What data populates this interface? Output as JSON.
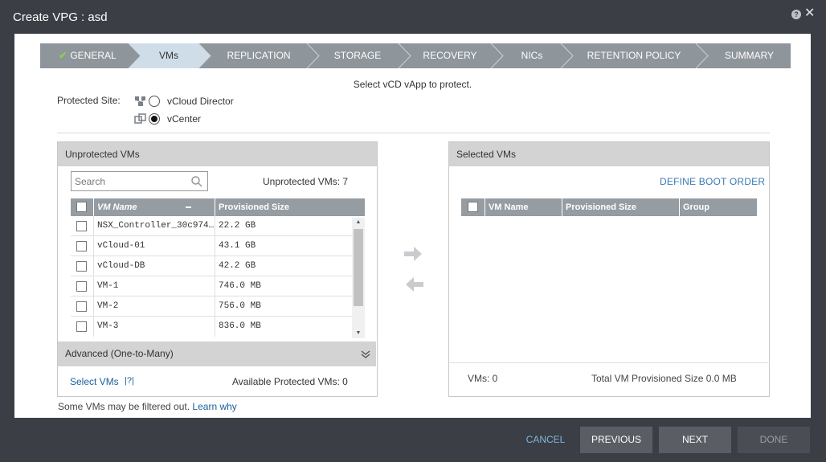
{
  "window": {
    "title": "Create VPG : asd"
  },
  "wizard": {
    "steps": [
      {
        "label": "GENERAL",
        "done": true
      },
      {
        "label": "VMs",
        "active": true
      },
      {
        "label": "REPLICATION"
      },
      {
        "label": "STORAGE"
      },
      {
        "label": "RECOVERY"
      },
      {
        "label": "NICs"
      },
      {
        "label": "RETENTION POLICY"
      },
      {
        "label": "SUMMARY"
      }
    ]
  },
  "instruction": "Select vCD vApp to protect.",
  "protected_site": {
    "label": "Protected Site:",
    "options": [
      {
        "label": "vCloud Director",
        "selected": false
      },
      {
        "label": "vCenter",
        "selected": true
      }
    ]
  },
  "unprotected": {
    "header": "Unprotected VMs",
    "search_placeholder": "Search",
    "count_text": "Unprotected VMs: 7",
    "columns": [
      "VM Name",
      "Provisioned Size"
    ],
    "rows": [
      {
        "name": "NSX_Controller_30c974...",
        "size": "22.2 GB"
      },
      {
        "name": "vCloud-01",
        "size": "43.1 GB"
      },
      {
        "name": "vCloud-DB",
        "size": "42.2 GB"
      },
      {
        "name": "VM-1",
        "size": "746.0 MB"
      },
      {
        "name": "VM-2",
        "size": "756.0 MB"
      },
      {
        "name": "VM-3",
        "size": "836.0 MB"
      }
    ],
    "advanced_label": "Advanced (One-to-Many)",
    "select_vms": "Select VMs",
    "help": "|?|",
    "available_text": "Available Protected VMs: 0"
  },
  "selected": {
    "header": "Selected VMs",
    "define_boot_order": "DEFINE BOOT ORDER",
    "columns": [
      "VM Name",
      "Provisioned Size",
      "Group"
    ],
    "vms_count": "VMs: 0",
    "total_size": "Total VM Provisioned Size 0.0 MB"
  },
  "filter_note": {
    "text": "Some VMs may be filtered out.",
    "link": "Learn why"
  },
  "footer": {
    "cancel": "CANCEL",
    "previous": "PREVIOUS",
    "next": "NEXT",
    "done": "DONE"
  },
  "colors": {
    "title_bar": "#3b3e44",
    "wizard_bg": "#8e959b",
    "wizard_active": "#cfdde8",
    "check": "#8ed04b",
    "link": "#1a5e9a"
  }
}
